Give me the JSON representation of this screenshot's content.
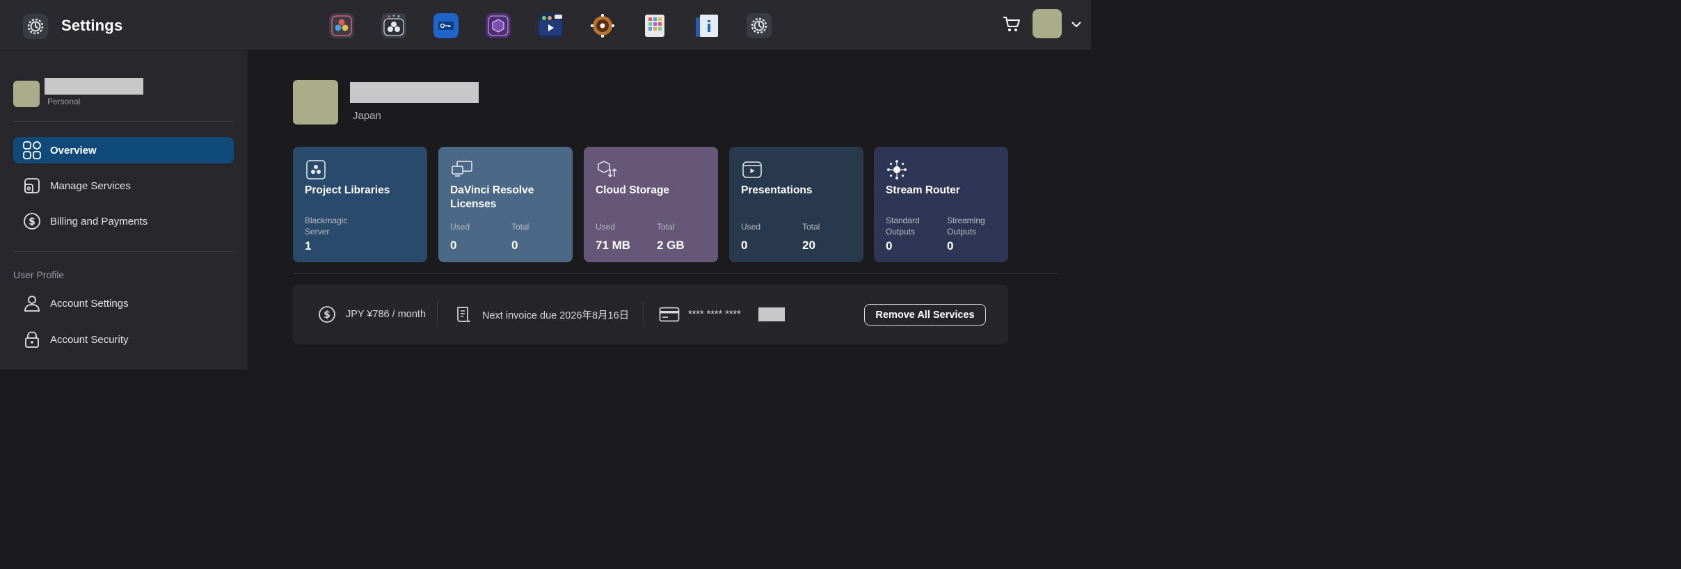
{
  "header": {
    "title": "Settings",
    "apps": [
      {
        "name": "davinci-resolve-icon"
      },
      {
        "name": "project-server-icon"
      },
      {
        "name": "license-manager-icon"
      },
      {
        "name": "cloud-store-icon"
      },
      {
        "name": "presentations-icon"
      },
      {
        "name": "stream-router-icon"
      },
      {
        "name": "stickies-icon"
      },
      {
        "name": "system-info-icon"
      },
      {
        "name": "settings-app-icon"
      }
    ]
  },
  "sidebar": {
    "account_type": "Personal",
    "nav": [
      {
        "label": "Overview",
        "icon": "overview-icon"
      },
      {
        "label": "Manage Services",
        "icon": "manage-services-icon"
      },
      {
        "label": "Billing and Payments",
        "icon": "dollar-icon"
      }
    ],
    "section_title": "User Profile",
    "profile_nav": [
      {
        "label": "Account Settings",
        "icon": "user-icon"
      },
      {
        "label": "Account Security",
        "icon": "lock-icon"
      }
    ]
  },
  "profile": {
    "country": "Japan"
  },
  "cards": [
    {
      "title": "Project Libraries",
      "color": "#2a4a6b",
      "stats": [
        {
          "label": "Blackmagic Server",
          "value": "1"
        }
      ]
    },
    {
      "title": "DaVinci Resolve Licenses",
      "color": "#4b6986",
      "stats": [
        {
          "label": "Used",
          "value": "0"
        },
        {
          "label": "Total",
          "value": "0"
        }
      ]
    },
    {
      "title": "Cloud Storage",
      "color": "#665677",
      "stats": [
        {
          "label": "Used",
          "value": "71 MB"
        },
        {
          "label": "Total",
          "value": "2 GB"
        }
      ]
    },
    {
      "title": "Presentations",
      "color": "#28394d",
      "stats": [
        {
          "label": "Used",
          "value": "0"
        },
        {
          "label": "Total",
          "value": "20"
        }
      ]
    },
    {
      "title": "Stream Router",
      "color": "#2f3555",
      "stats": [
        {
          "label": "Standard Outputs",
          "value": "0"
        },
        {
          "label": "Streaming Outputs",
          "value": "0"
        }
      ]
    }
  ],
  "billing": {
    "price": "JPY ¥786 / month",
    "next_invoice": "Next invoice due 2026年8月16日",
    "card_masked": "**** **** ****",
    "remove_button": "Remove All Services"
  },
  "colors": {
    "accent": "#0f4a7a",
    "avatar": "#a9ad8a"
  }
}
